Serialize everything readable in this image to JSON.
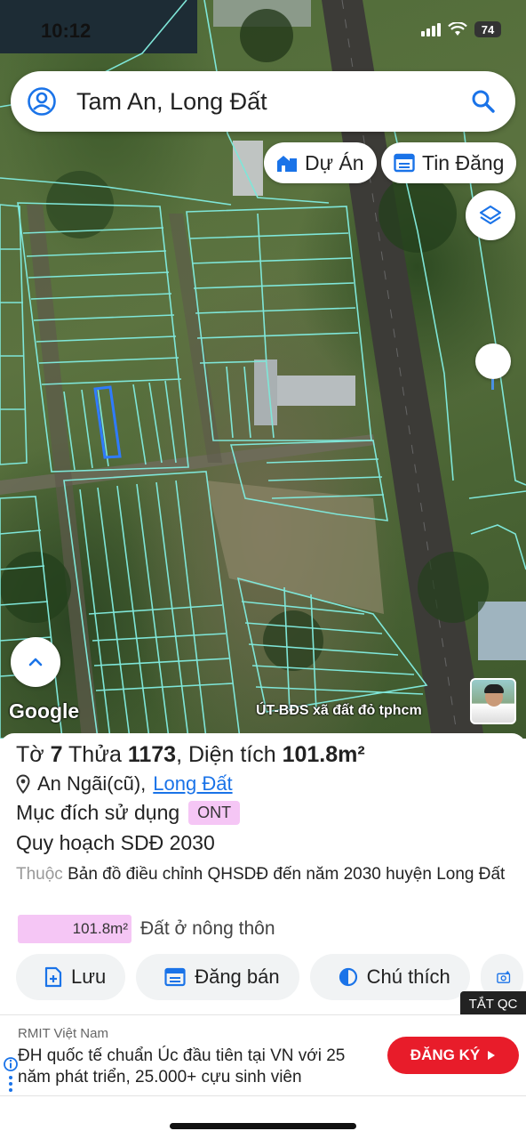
{
  "status_bar": {
    "time": "10:12",
    "battery": "74"
  },
  "search": {
    "query": "Tam An, Long Đất"
  },
  "chips": {
    "projects": "Dự Án",
    "listings": "Tin Đăng"
  },
  "map": {
    "attribution": "Google",
    "watermark": "ÚT-BĐS xã đất đỏ tphcm"
  },
  "parcel": {
    "title_prefix": "Tờ",
    "sheet_no": "7",
    "parcel_prefix": "Thửa",
    "parcel_no": "1173",
    "area_prefix": ", Diện tích",
    "area": "101.8m²",
    "commune": "An Ngãi(cũ),",
    "district_link": "Long Đất",
    "purpose_label": "Mục đích sử dụng",
    "purpose_code": "ONT",
    "plan_title": "Quy hoạch SDĐ 2030",
    "plan_prefix": "Thuộc",
    "plan_desc": "Bản đồ điều chỉnh QHSDĐ đến năm 2030 huyện Long Đất",
    "area_bar_value": "101.8m²",
    "area_bar_label": "Đất ở nông thôn"
  },
  "actions": {
    "save": "Lưu",
    "post_sale": "Đăng bán",
    "legend": "Chú thích"
  },
  "ad": {
    "close_label": "TẮT QC",
    "brand": "RMIT Việt Nam",
    "text": "ĐH quốc tế chuẩn Úc đầu tiên tại VN với 25 năm phát triển, 25.000+ cựu sinh viên",
    "cta": "ĐĂNG KÝ"
  },
  "colors": {
    "accent": "#1a73e8",
    "parcel_line": "#7fe6d8",
    "selected_parcel": "#2f7bff",
    "ont_badge": "#f5c6f5",
    "ad_cta": "#e81c2a"
  }
}
